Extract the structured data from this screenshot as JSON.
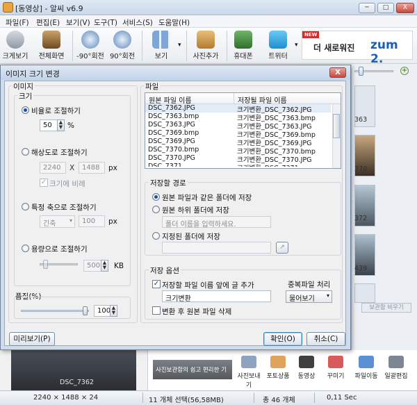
{
  "window": {
    "title": "[동영상] - 알씨 v6.9",
    "min": "─",
    "max": "□",
    "close": "X"
  },
  "menu": [
    "파일(F)",
    "편집(E)",
    "보기(V)",
    "도구(T)",
    "서비스(S)",
    "도움말(H)"
  ],
  "toolbar": {
    "items": [
      "크게보기",
      "전체화면",
      "-90°회전",
      "90°회전",
      "보기",
      "사진추가",
      "휴대폰",
      "트위터"
    ],
    "dropdown_arrow": "▾"
  },
  "banner": {
    "new": "NEW",
    "text": "더 새로워진",
    "brand": "zum 2."
  },
  "thumbnails": [
    "363",
    "370",
    "372",
    "439"
  ],
  "right_panel": {
    "button": "보관함 비우기"
  },
  "dialog": {
    "title": "이미지 크기 변경",
    "close": "X",
    "image_section": "이미지",
    "size_group": "크기",
    "ratio_option": "비율로 조절하기",
    "ratio_value": "50",
    "ratio_unit": "%",
    "resolution_option": "해상도로 조절하기",
    "width": "2240",
    "x_sep": "X",
    "height": "1488",
    "px": "px",
    "keep_ratio": "크기에 비례",
    "axis_option": "특정 축으로 조절하기",
    "axis_combo": "긴축",
    "axis_value": "100",
    "axis_unit": "px",
    "capacity_option": "용량으로 조절하기",
    "capacity_value": "500",
    "capacity_unit": "KB",
    "quality_label": "품질(%)",
    "quality_value": "100",
    "file_section": "파일",
    "col_original": "원본 파일 이름",
    "col_saved": "저장될 파일 이름",
    "files": [
      {
        "original": "DSC_7362.JPG",
        "saved": "크기변환_DSC_7362.JPG"
      },
      {
        "original": "DSC_7363.bmp",
        "saved": "크기변환_DSC_7363.bmp"
      },
      {
        "original": "DSC_7363.JPG",
        "saved": "크기변환_DSC_7363.JPG"
      },
      {
        "original": "DSC_7369.bmp",
        "saved": "크기변환_DSC_7369.bmp"
      },
      {
        "original": "DSC_7369.JPG",
        "saved": "크기변환_DSC_7369.JPG"
      },
      {
        "original": "DSC_7370.bmp",
        "saved": "크기변환_DSC_7370.bmp"
      },
      {
        "original": "DSC_7370.JPG",
        "saved": "크기변환_DSC_7370.JPG"
      },
      {
        "original": "DSC_7371...",
        "saved": "크기변환_DSC_7371..."
      }
    ],
    "save_path_group": "저장할 경로",
    "same_folder": "원본 파일과 같은 폴더에 저장",
    "sub_folder": "원본 하위 폴더에 저장",
    "folder_placeholder": "폴더 이름을 입력하세요.",
    "specified_folder": "지정된 폴더에 저장",
    "browse_icon": "↗",
    "save_options_group": "저장 옵션",
    "prefix_option": "저장할 파일 이름 앞에 글 추가",
    "prefix_value": "크기변환_",
    "duplicate_label": "중복파일 처리",
    "duplicate_combo": "물어보기",
    "delete_original": "변환 후 원본 파일 삭제",
    "preview_button": "미리보기(P)",
    "ok_button": "확인(O)",
    "cancel_button": "취소(C)"
  },
  "preview_label": "DSC_7362",
  "ad_text": "사진보관함의 쉽고 편리한 기",
  "bottom_tools": [
    "사진보내기",
    "포토상품",
    "동영상",
    "꾸미기",
    "파일이동",
    "일괄편집"
  ],
  "status": {
    "dims": "2240 × 1488 × 24",
    "selected": "11 개체 선택(56,58MB)",
    "total": "총 46 개체",
    "time": "0,11 Sec"
  }
}
